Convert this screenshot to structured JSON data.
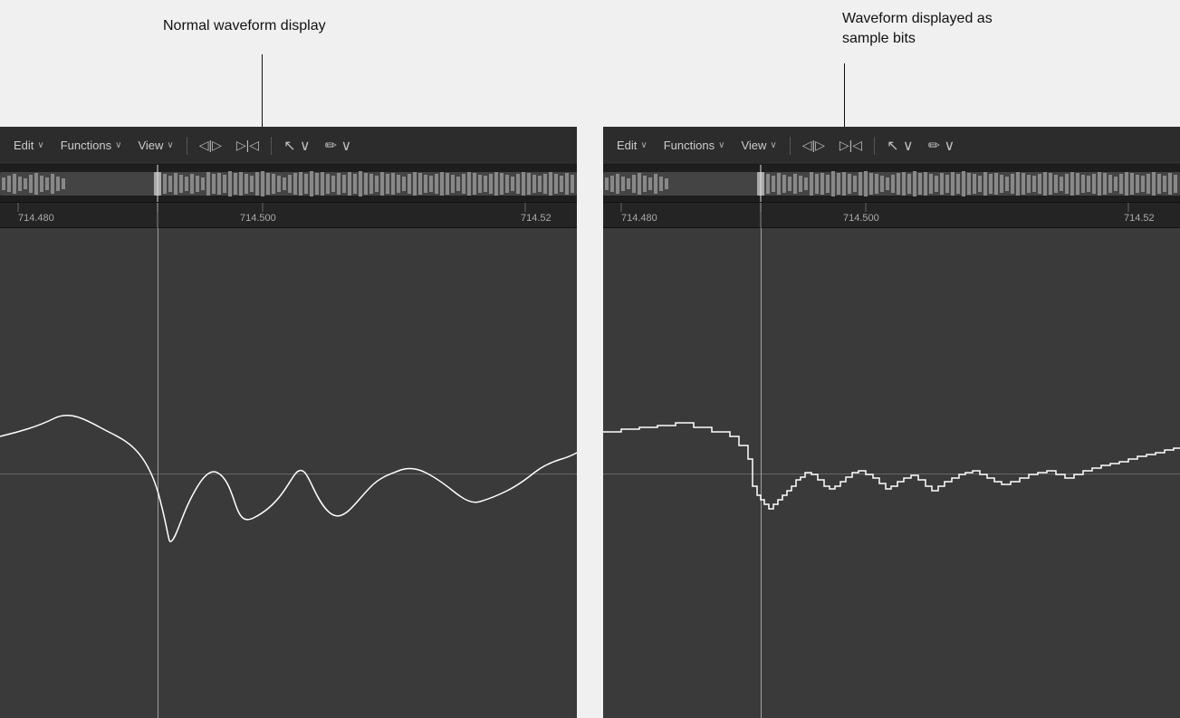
{
  "annotations": {
    "left_label": "Normal waveform display",
    "right_label_line1": "Waveform displayed as",
    "right_label_line2": "sample bits"
  },
  "toolbar": {
    "edit_label": "Edit",
    "functions_label": "Functions",
    "view_label": "View",
    "chevron": "∨"
  },
  "ruler": {
    "marker1": "714.480",
    "marker2": "714.500",
    "marker3": "714.52"
  },
  "panels": [
    "left",
    "right"
  ]
}
